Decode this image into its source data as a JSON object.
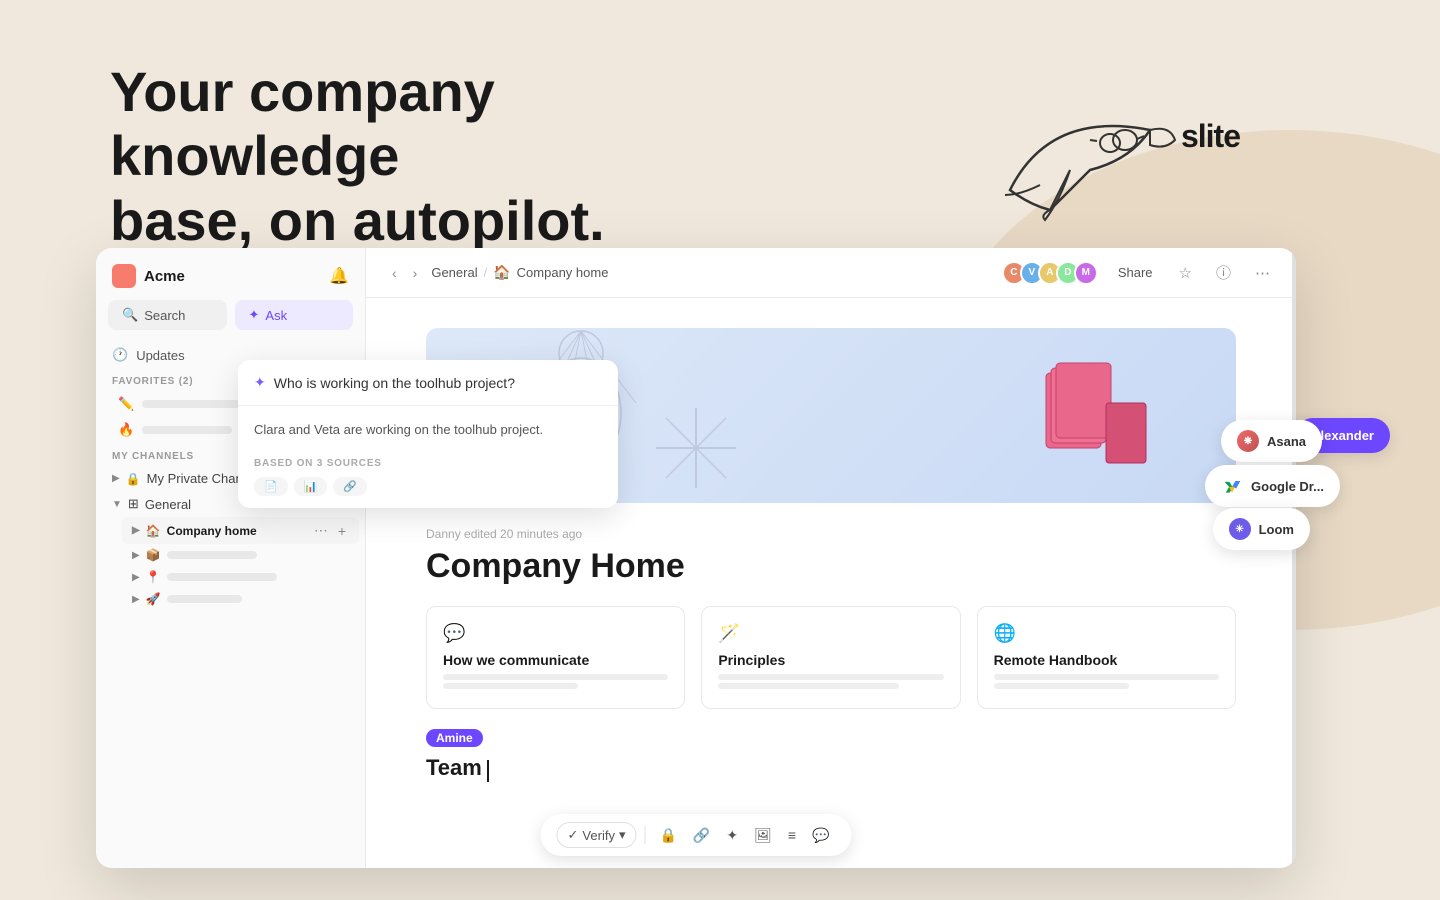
{
  "hero": {
    "heading_line1": "Your company knowledge",
    "heading_line2": "base, on autopilot.",
    "logo": "slite"
  },
  "sidebar": {
    "workspace": "Acme",
    "search_label": "Search",
    "ask_label": "Ask",
    "updates_label": "Updates",
    "favorites_label": "FAVORITES (2)",
    "my_channels_label": "MY CHANNELS",
    "private_channel_label": "My Private Channel",
    "general_label": "General",
    "company_home_label": "Company home",
    "sub_items": [
      {
        "icon": "🏠",
        "label": ""
      },
      {
        "icon": "📦",
        "label": ""
      },
      {
        "icon": "📍",
        "label": ""
      },
      {
        "icon": "🚀",
        "label": ""
      }
    ]
  },
  "toolbar": {
    "breadcrumb_general": "General",
    "breadcrumb_home": "Company home",
    "share_label": "Share"
  },
  "ai_popup": {
    "query": "Who is working on the toolhub project?",
    "answer": "Clara and Veta are working on the toolhub project.",
    "sources_label": "BASED ON 3 SOURCES"
  },
  "document": {
    "meta": "Danny edited 20 minutes ago",
    "title": "Company Home",
    "cards": [
      {
        "icon": "💬",
        "title": "How we communicate"
      },
      {
        "icon": "🪄",
        "title": "Principles"
      },
      {
        "icon": "🌐",
        "title": "Remote Handbook"
      }
    ],
    "tag": "Amine",
    "team_label": "Team"
  },
  "integrations": [
    {
      "name": "Asana",
      "type": "asana"
    },
    {
      "name": "Google Drive",
      "type": "gdrive"
    },
    {
      "name": "Loom",
      "type": "loom"
    }
  ],
  "editor_bar": {
    "verify_label": "Verify",
    "dropdown_icon": "▾"
  }
}
